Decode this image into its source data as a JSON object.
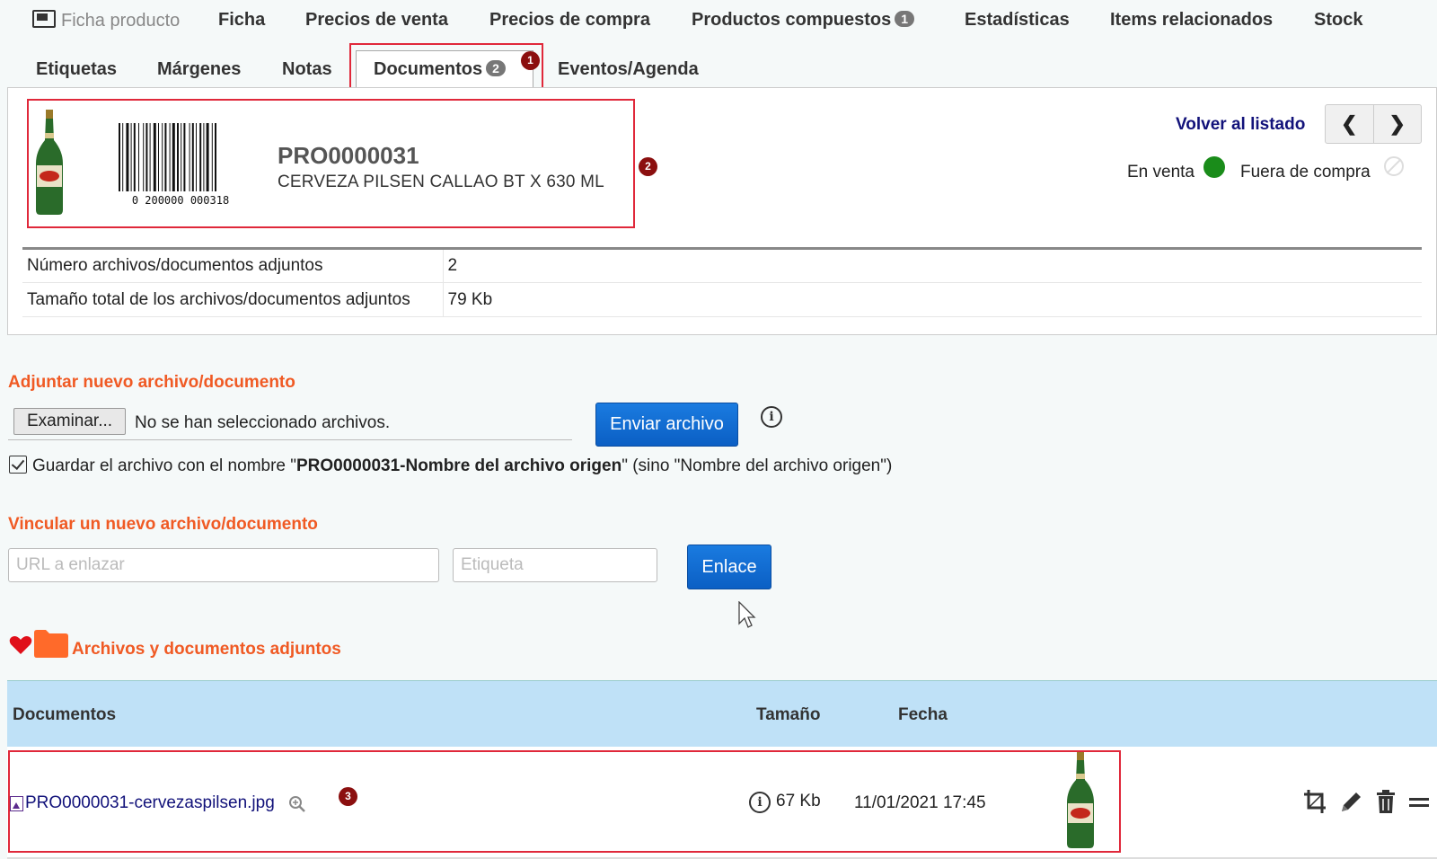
{
  "tabs_row1": [
    {
      "label": "Ficha producto",
      "icon": "monitor-icon"
    },
    {
      "label": "Ficha"
    },
    {
      "label": "Precios de venta"
    },
    {
      "label": "Precios de compra"
    },
    {
      "label": "Productos compuestos",
      "badge": "1"
    },
    {
      "label": "Estadísticas"
    },
    {
      "label": "Items relacionados"
    },
    {
      "label": "Stock"
    }
  ],
  "tabs_row2": [
    {
      "label": "Etiquetas"
    },
    {
      "label": "Márgenes"
    },
    {
      "label": "Notas"
    },
    {
      "label": "Documentos",
      "badge": "2",
      "active": true
    },
    {
      "label": "Eventos/Agenda"
    }
  ],
  "markers": [
    "1",
    "2",
    "3"
  ],
  "product": {
    "code": "PRO0000031",
    "name": "CERVEZA PILSEN CALLAO BT X 630 ML",
    "barcode_text": "0 200000 000318",
    "back_link": "Volver al listado",
    "status_on_sale": "En venta",
    "status_purchase": "Fuera de compra"
  },
  "info": [
    {
      "label": "Número archivos/documentos adjuntos",
      "value": "2"
    },
    {
      "label": "Tamaño total de los archivos/documentos adjuntos",
      "value": "79 Kb"
    }
  ],
  "upload": {
    "title": "Adjuntar nuevo archivo/documento",
    "browse_label": "Examinar...",
    "no_file_text": "No se han seleccionado archivos.",
    "send_label": "Enviar archivo",
    "checkbox_prefix": "Guardar el archivo con el nombre \"",
    "checkbox_bold": "PRO0000031-Nombre del archivo origen",
    "checkbox_suffix": "\" (sino \"Nombre del archivo origen\")"
  },
  "link": {
    "title": "Vincular un nuevo archivo/documento",
    "url_placeholder": "URL a enlazar",
    "label_placeholder": "Etiqueta",
    "button_label": "Enlace"
  },
  "attachments": {
    "title": "Archivos y documentos adjuntos",
    "columns": [
      "Documentos",
      "Tamaño",
      "Fecha"
    ],
    "rows": [
      {
        "file": "PRO0000031-cervezaspilsen.jpg",
        "size": "67 Kb",
        "date": "11/01/2021 17:45"
      }
    ]
  },
  "colors": {
    "accent": "#f05a24",
    "link": "#12127a",
    "primary_button": "#0b5fc4",
    "header_bg": "#bfe1f7",
    "marker": "#8b0f0f",
    "highlight": "#e0283a"
  }
}
